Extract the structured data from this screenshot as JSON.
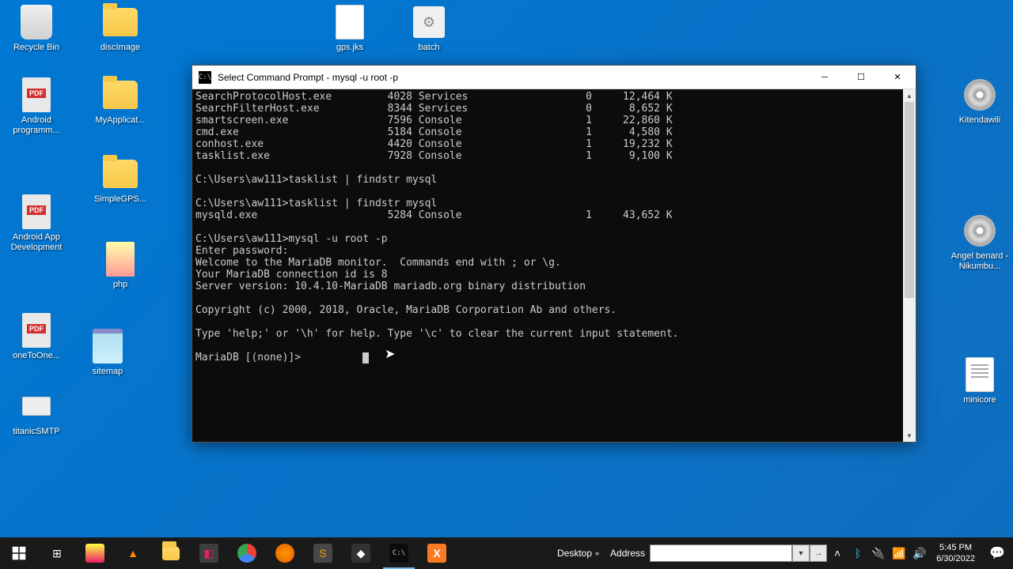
{
  "desktop_icons": {
    "recycle_bin": "Recycle Bin",
    "disc_image": "discImage",
    "gps_jks": "gps.jks",
    "batch": "batch",
    "android_prog": "Android programm...",
    "my_applicant": "MyApplicat...",
    "kitendawili": "Kitendawili",
    "simple_gps": "SimpleGPS...",
    "android_app_dev": "Android App Development",
    "angel_benard": "Angel benard - Nikumbu...",
    "php": "php",
    "one_to_one": "oneToOne...",
    "sitemap": "sitemap",
    "minicore": "minicore",
    "titanic_smtp": "titanicSMTP"
  },
  "cmd": {
    "title": "Select Command Prompt - mysql  -u root -p",
    "lines": [
      "SearchProtocolHost.exe         4028 Services                   0     12,464 K",
      "SearchFilterHost.exe           8344 Services                   0      8,652 K",
      "smartscreen.exe                7596 Console                    1     22,860 K",
      "cmd.exe                        5184 Console                    1      4,580 K",
      "conhost.exe                    4420 Console                    1     19,232 K",
      "tasklist.exe                   7928 Console                    1      9,100 K",
      "",
      "C:\\Users\\aw111>tasklist | findstr mysql",
      "",
      "C:\\Users\\aw111>tasklist | findstr mysql",
      "mysqld.exe                     5284 Console                    1     43,652 K",
      "",
      "C:\\Users\\aw111>mysql -u root -p",
      "Enter password:",
      "Welcome to the MariaDB monitor.  Commands end with ; or \\g.",
      "Your MariaDB connection id is 8",
      "Server version: 10.4.10-MariaDB mariadb.org binary distribution",
      "",
      "Copyright (c) 2000, 2018, Oracle, MariaDB Corporation Ab and others.",
      "",
      "Type 'help;' or '\\h' for help. Type '\\c' to clear the current input statement.",
      "",
      "MariaDB [(none)]>"
    ]
  },
  "taskbar": {
    "desktop_label": "Desktop",
    "address_label": "Address",
    "address_value": "",
    "time": "5:45 PM",
    "date": "6/30/2022"
  }
}
